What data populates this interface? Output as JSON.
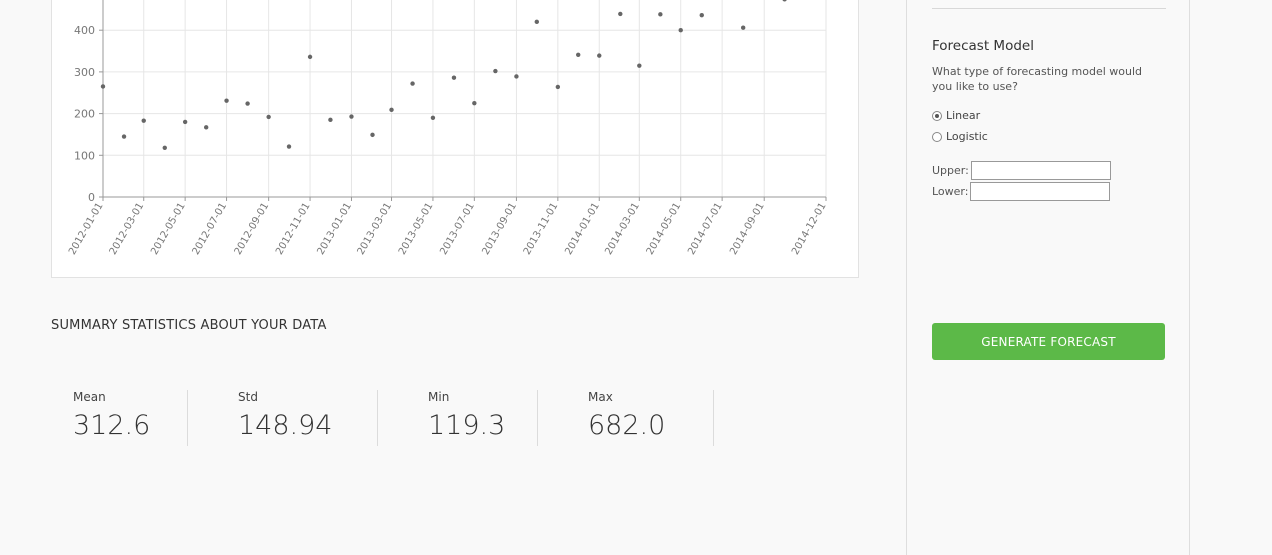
{
  "chart_data": {
    "type": "scatter",
    "title": "",
    "xlabel": "",
    "ylabel": "",
    "x_tick_labels": [
      "2012-01-01",
      "2012-03-01",
      "2012-05-01",
      "2012-07-01",
      "2012-09-01",
      "2012-11-01",
      "2013-01-01",
      "2013-03-01",
      "2013-05-01",
      "2013-07-01",
      "2013-09-01",
      "2013-11-01",
      "2014-01-01",
      "2014-03-01",
      "2014-05-01",
      "2014-07-01",
      "2014-09-01",
      "2014-12-01"
    ],
    "y_tick_labels": [
      "0",
      "100",
      "200",
      "300",
      "400"
    ],
    "xlim": [
      "2012-01-01",
      "2014-12-01"
    ],
    "ylim": [
      0,
      470
    ],
    "grid": true,
    "points": [
      {
        "x": "2012-01-01",
        "y": 265
      },
      {
        "x": "2012-02-01",
        "y": 145
      },
      {
        "x": "2012-03-01",
        "y": 183
      },
      {
        "x": "2012-04-01",
        "y": 118
      },
      {
        "x": "2012-05-01",
        "y": 180
      },
      {
        "x": "2012-06-01",
        "y": 167
      },
      {
        "x": "2012-07-01",
        "y": 231
      },
      {
        "x": "2012-08-01",
        "y": 224
      },
      {
        "x": "2012-09-01",
        "y": 192
      },
      {
        "x": "2012-10-01",
        "y": 121
      },
      {
        "x": "2012-11-01",
        "y": 336
      },
      {
        "x": "2012-12-01",
        "y": 185
      },
      {
        "x": "2013-01-01",
        "y": 193
      },
      {
        "x": "2013-02-01",
        "y": 149
      },
      {
        "x": "2013-03-01",
        "y": 209
      },
      {
        "x": "2013-04-01",
        "y": 272
      },
      {
        "x": "2013-05-01",
        "y": 190
      },
      {
        "x": "2013-06-01",
        "y": 286
      },
      {
        "x": "2013-07-01",
        "y": 225
      },
      {
        "x": "2013-08-01",
        "y": 302
      },
      {
        "x": "2013-09-01",
        "y": 289
      },
      {
        "x": "2013-10-01",
        "y": 420
      },
      {
        "x": "2013-11-01",
        "y": 264
      },
      {
        "x": "2013-12-01",
        "y": 341
      },
      {
        "x": "2014-01-01",
        "y": 339
      },
      {
        "x": "2014-02-01",
        "y": 439
      },
      {
        "x": "2014-03-01",
        "y": 315
      },
      {
        "x": "2014-04-01",
        "y": 438
      },
      {
        "x": "2014-05-01",
        "y": 400
      },
      {
        "x": "2014-06-01",
        "y": 436
      },
      {
        "x": "2014-08-01",
        "y": 406
      },
      {
        "x": "2014-10-01",
        "y": 474
      }
    ]
  },
  "summary": {
    "title": "SUMMARY STATISTICS ABOUT YOUR DATA",
    "stats": [
      {
        "label": "Mean",
        "value": "312.6"
      },
      {
        "label": "Std",
        "value": "148.94"
      },
      {
        "label": "Min",
        "value": "119.3"
      },
      {
        "label": "Max",
        "value": "682.0"
      }
    ]
  },
  "sidebar": {
    "forecast_model_title": "Forecast Model",
    "forecast_model_question": "What type of forecasting model would you like to use?",
    "radio_options": [
      {
        "label": "Linear",
        "checked": true
      },
      {
        "label": "Logistic",
        "checked": false
      }
    ],
    "upper_label": "Upper:",
    "upper_value": "",
    "lower_label": "Lower:",
    "lower_value": "",
    "generate_button_label": "GENERATE FORECAST"
  },
  "colors": {
    "button_green": "#5cb948",
    "point_color": "#666666",
    "grid_color": "#e6e6e6"
  }
}
